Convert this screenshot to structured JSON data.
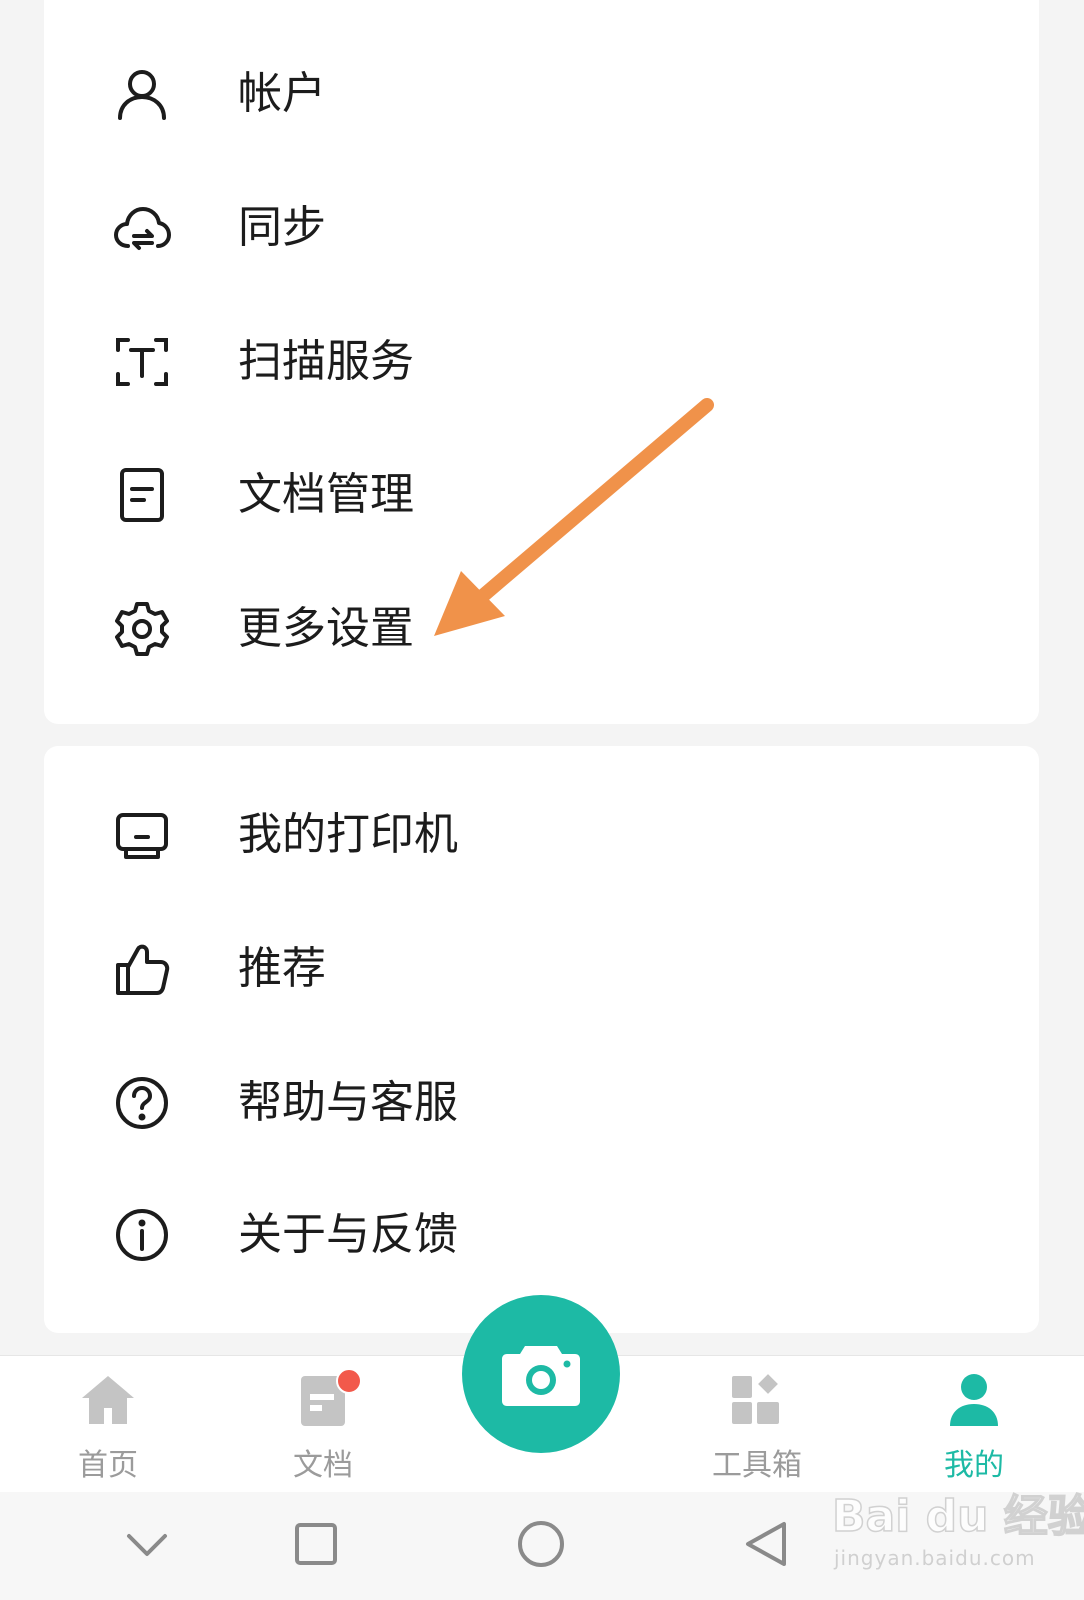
{
  "menu_group_1": [
    {
      "label": "帐户",
      "icon": "user-icon"
    },
    {
      "label": "同步",
      "icon": "cloud-sync-icon"
    },
    {
      "label": "扫描服务",
      "icon": "text-scan-icon"
    },
    {
      "label": "文档管理",
      "icon": "document-icon"
    },
    {
      "label": "更多设置",
      "icon": "gear-icon"
    }
  ],
  "menu_group_2": [
    {
      "label": "我的打印机",
      "icon": "printer-icon"
    },
    {
      "label": "推荐",
      "icon": "thumbs-up-icon"
    },
    {
      "label": "帮助与客服",
      "icon": "help-circle-icon"
    },
    {
      "label": "关于与反馈",
      "icon": "info-circle-icon"
    }
  ],
  "bottom_nav": {
    "tabs": [
      {
        "label": "首页",
        "icon": "home-icon",
        "active": false
      },
      {
        "label": "文档",
        "icon": "docs-icon",
        "active": false,
        "badge": true
      },
      {
        "label": "工具箱",
        "icon": "toolbox-icon",
        "active": false
      },
      {
        "label": "我的",
        "icon": "profile-icon",
        "active": true
      }
    ],
    "center_button_icon": "camera-icon"
  },
  "colors": {
    "accent": "#1dbaa5",
    "badge": "#f2594b",
    "annotation_arrow": "#f0924a"
  },
  "watermark": {
    "text": "Bai du 经验",
    "sub": "jingyan.baidu.com"
  }
}
